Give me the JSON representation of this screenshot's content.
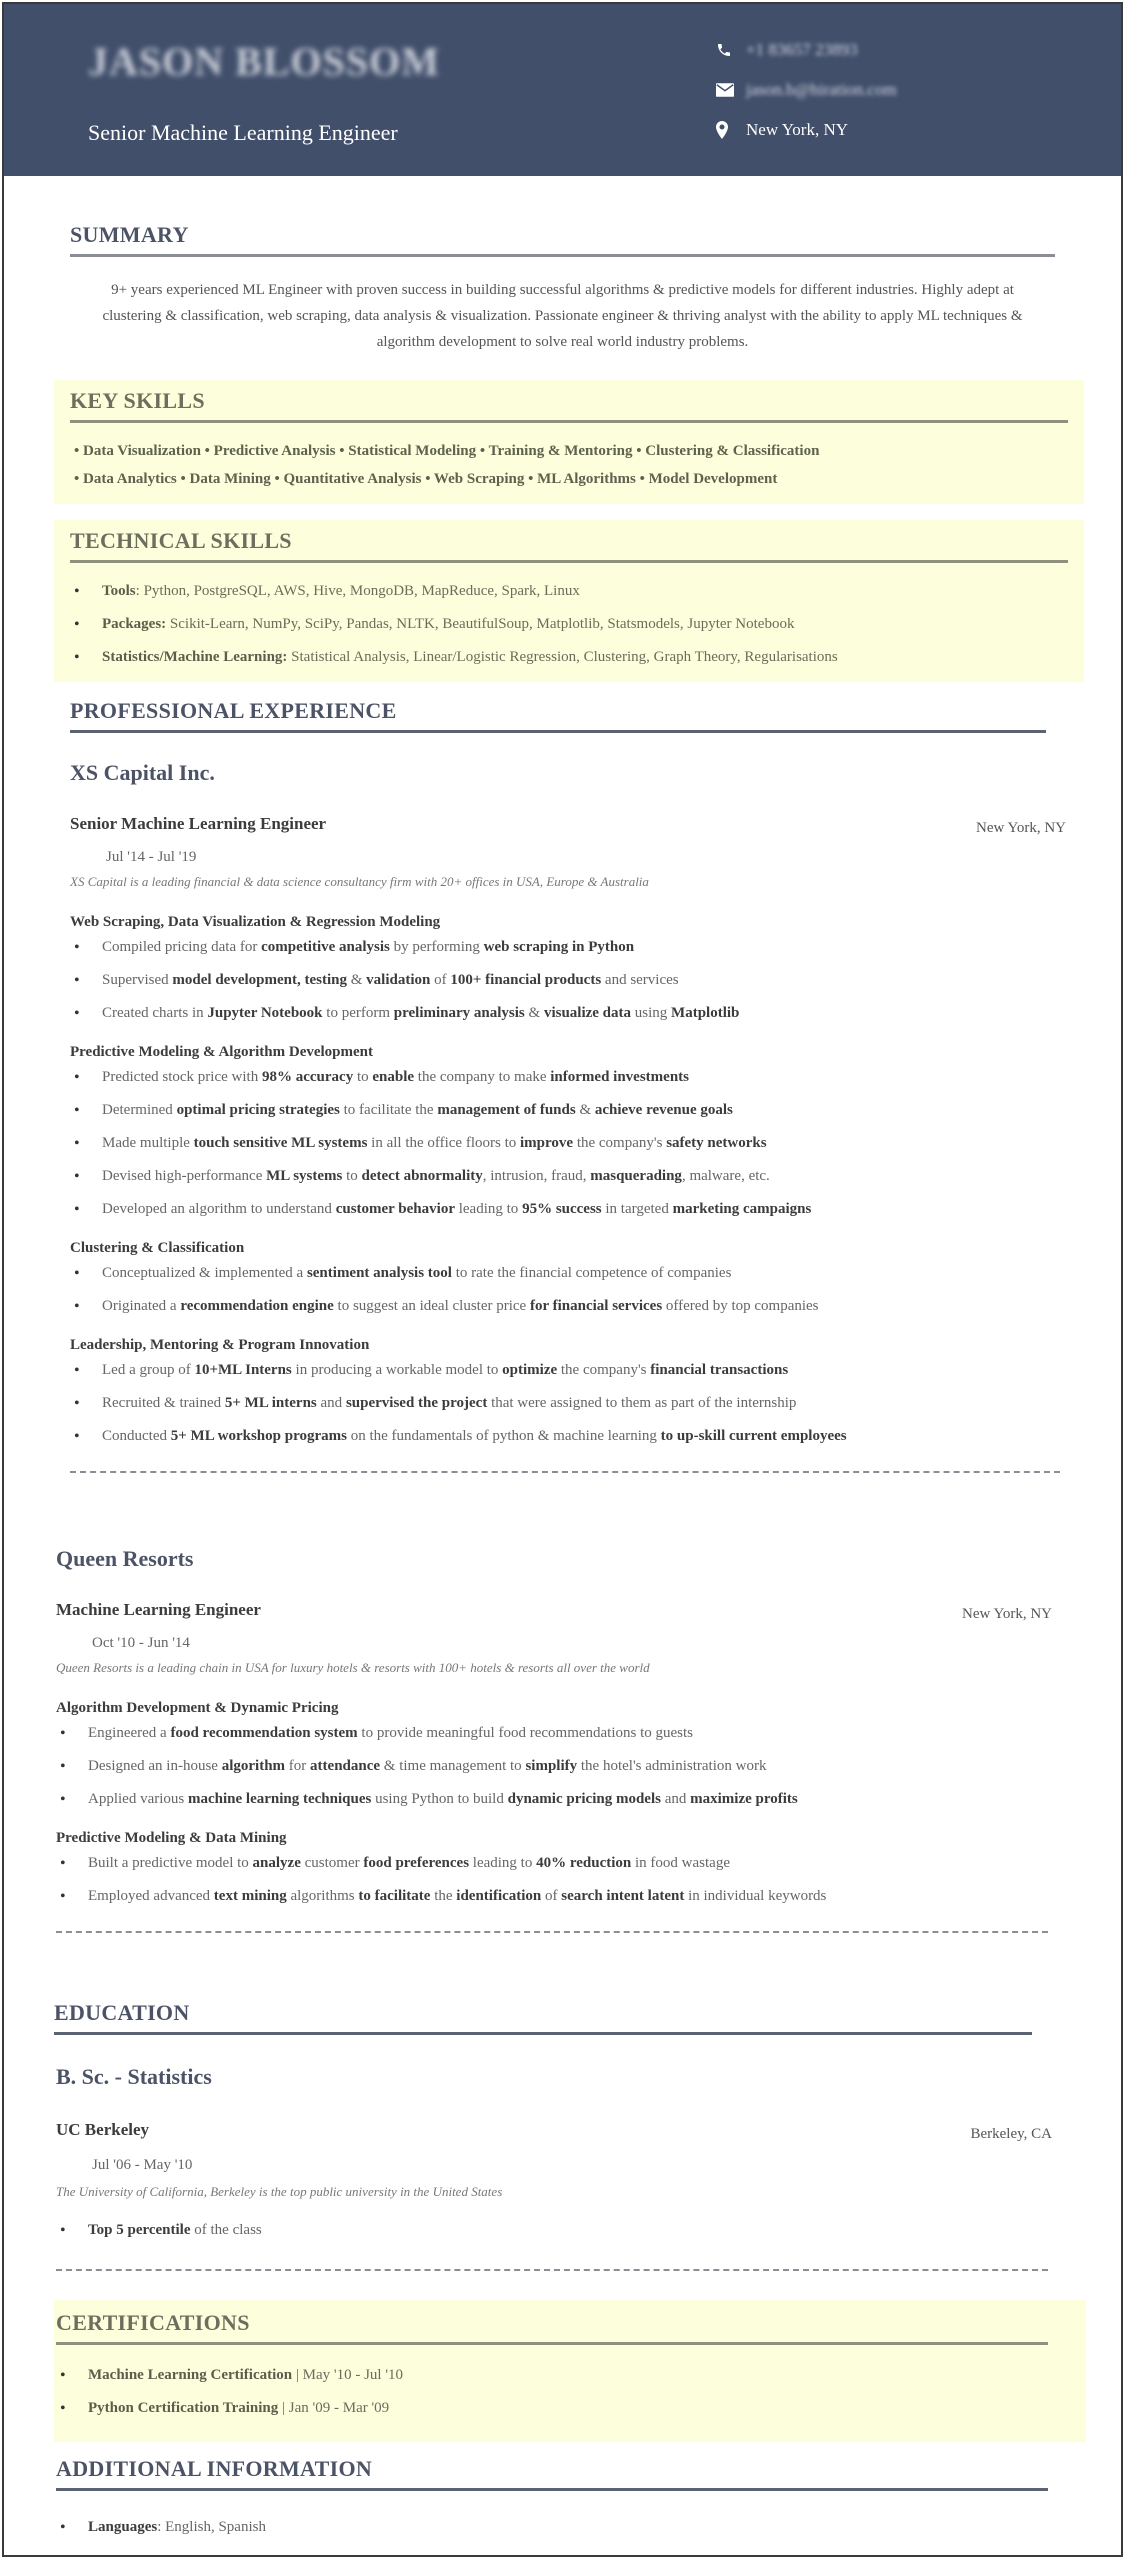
{
  "header": {
    "name": "JASON BLOSSOM",
    "headline": "Senior Machine Learning Engineer",
    "contacts": [
      {
        "icon": "phone-icon",
        "text": "+1 83657 23893",
        "blurred": true
      },
      {
        "icon": "email-icon",
        "text": "jason.b@hiration.com",
        "blurred": true
      },
      {
        "icon": "location-icon",
        "text": "New York, NY",
        "blurred": false
      }
    ]
  },
  "summary": {
    "title": "SUMMARY",
    "text": "9+ years experienced ML Engineer with proven success in building successful algorithms & predictive models for different industries. Highly adept at clustering & classification, web scraping, data analysis & visualization. Passionate engineer & thriving analyst with the ability to apply ML techniques & algorithm development to solve real world industry problems."
  },
  "key_skills": {
    "title": "KEY SKILLS",
    "lines": [
      "• Data Visualization • Predictive Analysis • Statistical Modeling • Training & Mentoring • Clustering & Classification",
      "• Data Analytics • Data Mining • Quantitative Analysis • Web Scraping • ML Algorithms • Model Development"
    ]
  },
  "technical_skills": {
    "title": "TECHNICAL SKILLS",
    "items": [
      {
        "label": "Tools",
        "sep": ": ",
        "value": "Python, PostgreSQL, AWS, Hive, MongoDB, MapReduce, Spark, Linux"
      },
      {
        "label": "Packages:",
        "sep": " ",
        "value": "Scikit-Learn, NumPy, SciPy, Pandas, NLTK, BeautifulSoup, Matplotlib, Statsmodels, Jupyter Notebook"
      },
      {
        "label": "Statistics/Machine Learning:",
        "sep": " ",
        "value": "Statistical Analysis, Linear/Logistic Regression, Clustering, Graph Theory, Regularisations"
      }
    ]
  },
  "experience": {
    "title": "PROFESSIONAL EXPERIENCE",
    "jobs": [
      {
        "company": "XS Capital Inc.",
        "role": "Senior Machine Learning Engineer",
        "location": "New York, NY",
        "dates": "Jul '14 - Jul '19",
        "description": "XS Capital is a leading financial & data science consultancy firm with 20+ offices in USA, Europe & Australia",
        "groups": [
          {
            "heading": "Web Scraping, Data Visualization & Regression Modeling",
            "bullets": [
              [
                {
                  "t": "Compiled pricing data for "
                },
                {
                  "t": "competitive analysis",
                  "b": true
                },
                {
                  "t": " by performing "
                },
                {
                  "t": "web scraping in Python",
                  "b": true
                }
              ],
              [
                {
                  "t": "Supervised "
                },
                {
                  "t": "model development, testing",
                  "b": true
                },
                {
                  "t": " & "
                },
                {
                  "t": "validation",
                  "b": true
                },
                {
                  "t": " of "
                },
                {
                  "t": "100+ financial products",
                  "b": true
                },
                {
                  "t": " and services"
                }
              ],
              [
                {
                  "t": "Created charts in "
                },
                {
                  "t": "Jupyter Notebook",
                  "b": true
                },
                {
                  "t": " to perform "
                },
                {
                  "t": "preliminary analysis",
                  "b": true
                },
                {
                  "t": " & "
                },
                {
                  "t": "visualize data",
                  "b": true
                },
                {
                  "t": " using "
                },
                {
                  "t": "Matplotlib",
                  "b": true
                }
              ]
            ]
          },
          {
            "heading": "Predictive Modeling & Algorithm Development",
            "bullets": [
              [
                {
                  "t": "Predicted stock price with "
                },
                {
                  "t": "98% accuracy",
                  "b": true
                },
                {
                  "t": " to "
                },
                {
                  "t": "enable",
                  "b": true
                },
                {
                  "t": " the company to make "
                },
                {
                  "t": "informed investments",
                  "b": true
                }
              ],
              [
                {
                  "t": "Determined "
                },
                {
                  "t": "optimal pricing strategies",
                  "b": true
                },
                {
                  "t": " to facilitate the "
                },
                {
                  "t": "management of funds",
                  "b": true
                },
                {
                  "t": " & "
                },
                {
                  "t": "achieve revenue goals",
                  "b": true
                }
              ],
              [
                {
                  "t": "Made multiple "
                },
                {
                  "t": "touch sensitive ML systems",
                  "b": true
                },
                {
                  "t": " in all the office floors to "
                },
                {
                  "t": "improve",
                  "b": true
                },
                {
                  "t": " the company's "
                },
                {
                  "t": "safety networks",
                  "b": true
                }
              ],
              [
                {
                  "t": "Devised high-performance "
                },
                {
                  "t": "ML systems",
                  "b": true
                },
                {
                  "t": " to "
                },
                {
                  "t": "detect abnormality",
                  "b": true
                },
                {
                  "t": ", intrusion, fraud, "
                },
                {
                  "t": "masquerading",
                  "b": true
                },
                {
                  "t": ", malware, etc."
                }
              ],
              [
                {
                  "t": "Developed an algorithm to understand "
                },
                {
                  "t": "customer behavior",
                  "b": true
                },
                {
                  "t": " leading to "
                },
                {
                  "t": "95% success",
                  "b": true
                },
                {
                  "t": " in targeted "
                },
                {
                  "t": "marketing campaigns",
                  "b": true
                }
              ]
            ]
          },
          {
            "heading": "Clustering & Classification",
            "bullets": [
              [
                {
                  "t": "Conceptualized & implemented a "
                },
                {
                  "t": "sentiment analysis tool",
                  "b": true
                },
                {
                  "t": " to rate the financial competence of companies"
                }
              ],
              [
                {
                  "t": "Originated a "
                },
                {
                  "t": "recommendation engine",
                  "b": true
                },
                {
                  "t": " to suggest an ideal cluster price "
                },
                {
                  "t": "for financial services",
                  "b": true
                },
                {
                  "t": " offered by top companies"
                }
              ]
            ]
          },
          {
            "heading": "Leadership, Mentoring & Program Innovation",
            "bullets": [
              [
                {
                  "t": "Led a group of "
                },
                {
                  "t": "10+ML Interns",
                  "b": true
                },
                {
                  "t": " in producing a workable model to "
                },
                {
                  "t": "optimize",
                  "b": true
                },
                {
                  "t": " the company's "
                },
                {
                  "t": "financial transactions",
                  "b": true
                }
              ],
              [
                {
                  "t": "Recruited & trained "
                },
                {
                  "t": "5+ ML interns",
                  "b": true
                },
                {
                  "t": " and "
                },
                {
                  "t": "supervised the project",
                  "b": true
                },
                {
                  "t": " that were assigned to them as part of the internship"
                }
              ],
              [
                {
                  "t": "Conducted "
                },
                {
                  "t": "5+ ML workshop programs",
                  "b": true
                },
                {
                  "t": " on the fundamentals of python & machine learning "
                },
                {
                  "t": "to up-skill current employees",
                  "b": true
                }
              ]
            ]
          }
        ]
      },
      {
        "company": "Queen Resorts",
        "role": "Machine Learning Engineer",
        "location": "New York, NY",
        "dates": "Oct '10 - Jun '14",
        "description": "Queen Resorts is a leading chain in USA for luxury hotels & resorts with 100+ hotels & resorts all over the world",
        "groups": [
          {
            "heading": "Algorithm Development & Dynamic Pricing",
            "bullets": [
              [
                {
                  "t": "Engineered a "
                },
                {
                  "t": "food recommendation system",
                  "b": true
                },
                {
                  "t": " to provide meaningful food recommendations to guests"
                }
              ],
              [
                {
                  "t": "Designed an in-house "
                },
                {
                  "t": "algorithm",
                  "b": true
                },
                {
                  "t": " for "
                },
                {
                  "t": "attendance",
                  "b": true
                },
                {
                  "t": " & time management to "
                },
                {
                  "t": "simplify",
                  "b": true
                },
                {
                  "t": " the hotel's administration work"
                }
              ],
              [
                {
                  "t": "Applied various "
                },
                {
                  "t": "machine learning techniques",
                  "b": true
                },
                {
                  "t": " using Python to build "
                },
                {
                  "t": "dynamic pricing models",
                  "b": true
                },
                {
                  "t": " and "
                },
                {
                  "t": "maximize profits",
                  "b": true
                }
              ]
            ]
          },
          {
            "heading": "Predictive Modeling & Data Mining",
            "bullets": [
              [
                {
                  "t": "Built a predictive model to "
                },
                {
                  "t": "analyze",
                  "b": true
                },
                {
                  "t": " customer "
                },
                {
                  "t": "food preferences",
                  "b": true
                },
                {
                  "t": " leading to "
                },
                {
                  "t": "40% reduction",
                  "b": true
                },
                {
                  "t": " in food wastage"
                }
              ],
              [
                {
                  "t": "Employed advanced "
                },
                {
                  "t": "text mining",
                  "b": true
                },
                {
                  "t": " algorithms "
                },
                {
                  "t": "to facilitate",
                  "b": true
                },
                {
                  "t": " the "
                },
                {
                  "t": "identification",
                  "b": true
                },
                {
                  "t": " of "
                },
                {
                  "t": "search intent latent",
                  "b": true
                },
                {
                  "t": " in individual keywords"
                }
              ]
            ]
          }
        ]
      }
    ]
  },
  "education": {
    "title": "EDUCATION",
    "degree": "B. Sc. - Statistics",
    "school": "UC Berkeley",
    "location": "Berkeley, CA",
    "dates": "Jul '06 - May '10",
    "description": "The University of California, Berkeley is the top public university in the United States",
    "bullets": [
      [
        {
          "t": "Top 5 percentile",
          "b": true
        },
        {
          "t": " of the class"
        }
      ]
    ]
  },
  "certifications": {
    "title": "CERTIFICATIONS",
    "items": [
      {
        "name": "Machine Learning Certification",
        "dates": " | May '10 - Jul '10"
      },
      {
        "name": "Python Certification Training",
        "dates": " | Jan '09 - Mar '09"
      }
    ]
  },
  "additional": {
    "title": "ADDITIONAL INFORMATION",
    "items": [
      {
        "label": "Languages",
        "sep": ": ",
        "value": "English, Spanish"
      }
    ]
  },
  "colors": {
    "header_bg": "#414f6b",
    "highlight_bg": "#fdfedb",
    "heading": "#4c5366"
  }
}
